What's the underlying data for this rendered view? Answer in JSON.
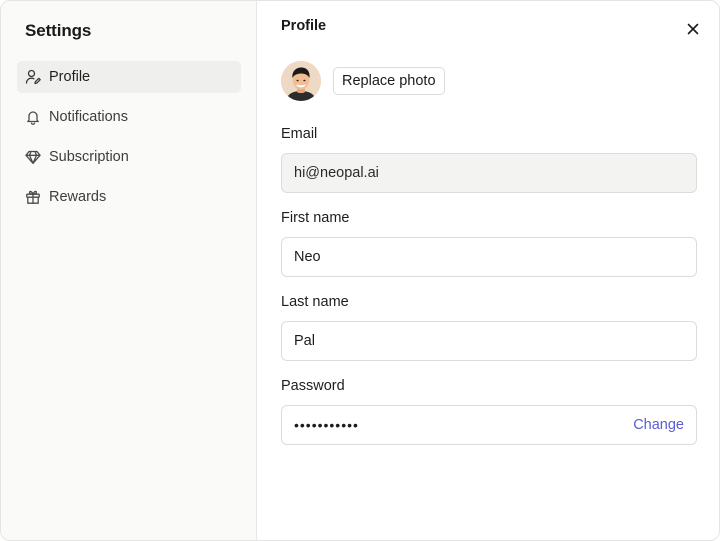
{
  "sidebar": {
    "title": "Settings",
    "items": [
      {
        "label": "Profile",
        "icon": "user-edit-icon",
        "active": true
      },
      {
        "label": "Notifications",
        "icon": "bell-icon",
        "active": false
      },
      {
        "label": "Subscription",
        "icon": "diamond-icon",
        "active": false
      },
      {
        "label": "Rewards",
        "icon": "gift-icon",
        "active": false
      }
    ]
  },
  "main": {
    "title": "Profile",
    "replace_photo_label": "Replace photo",
    "fields": {
      "email": {
        "label": "Email",
        "value": "hi@neopal.ai"
      },
      "first_name": {
        "label": "First name",
        "value": "Neo"
      },
      "last_name": {
        "label": "Last name",
        "value": "Pal"
      },
      "password": {
        "label": "Password",
        "value": "•••••••••••",
        "action": "Change"
      }
    }
  },
  "colors": {
    "accent": "#5b5bd6",
    "sidebar_bg": "#fafaf9",
    "active_item_bg": "#efefed",
    "readonly_field_bg": "#f3f3f2"
  }
}
